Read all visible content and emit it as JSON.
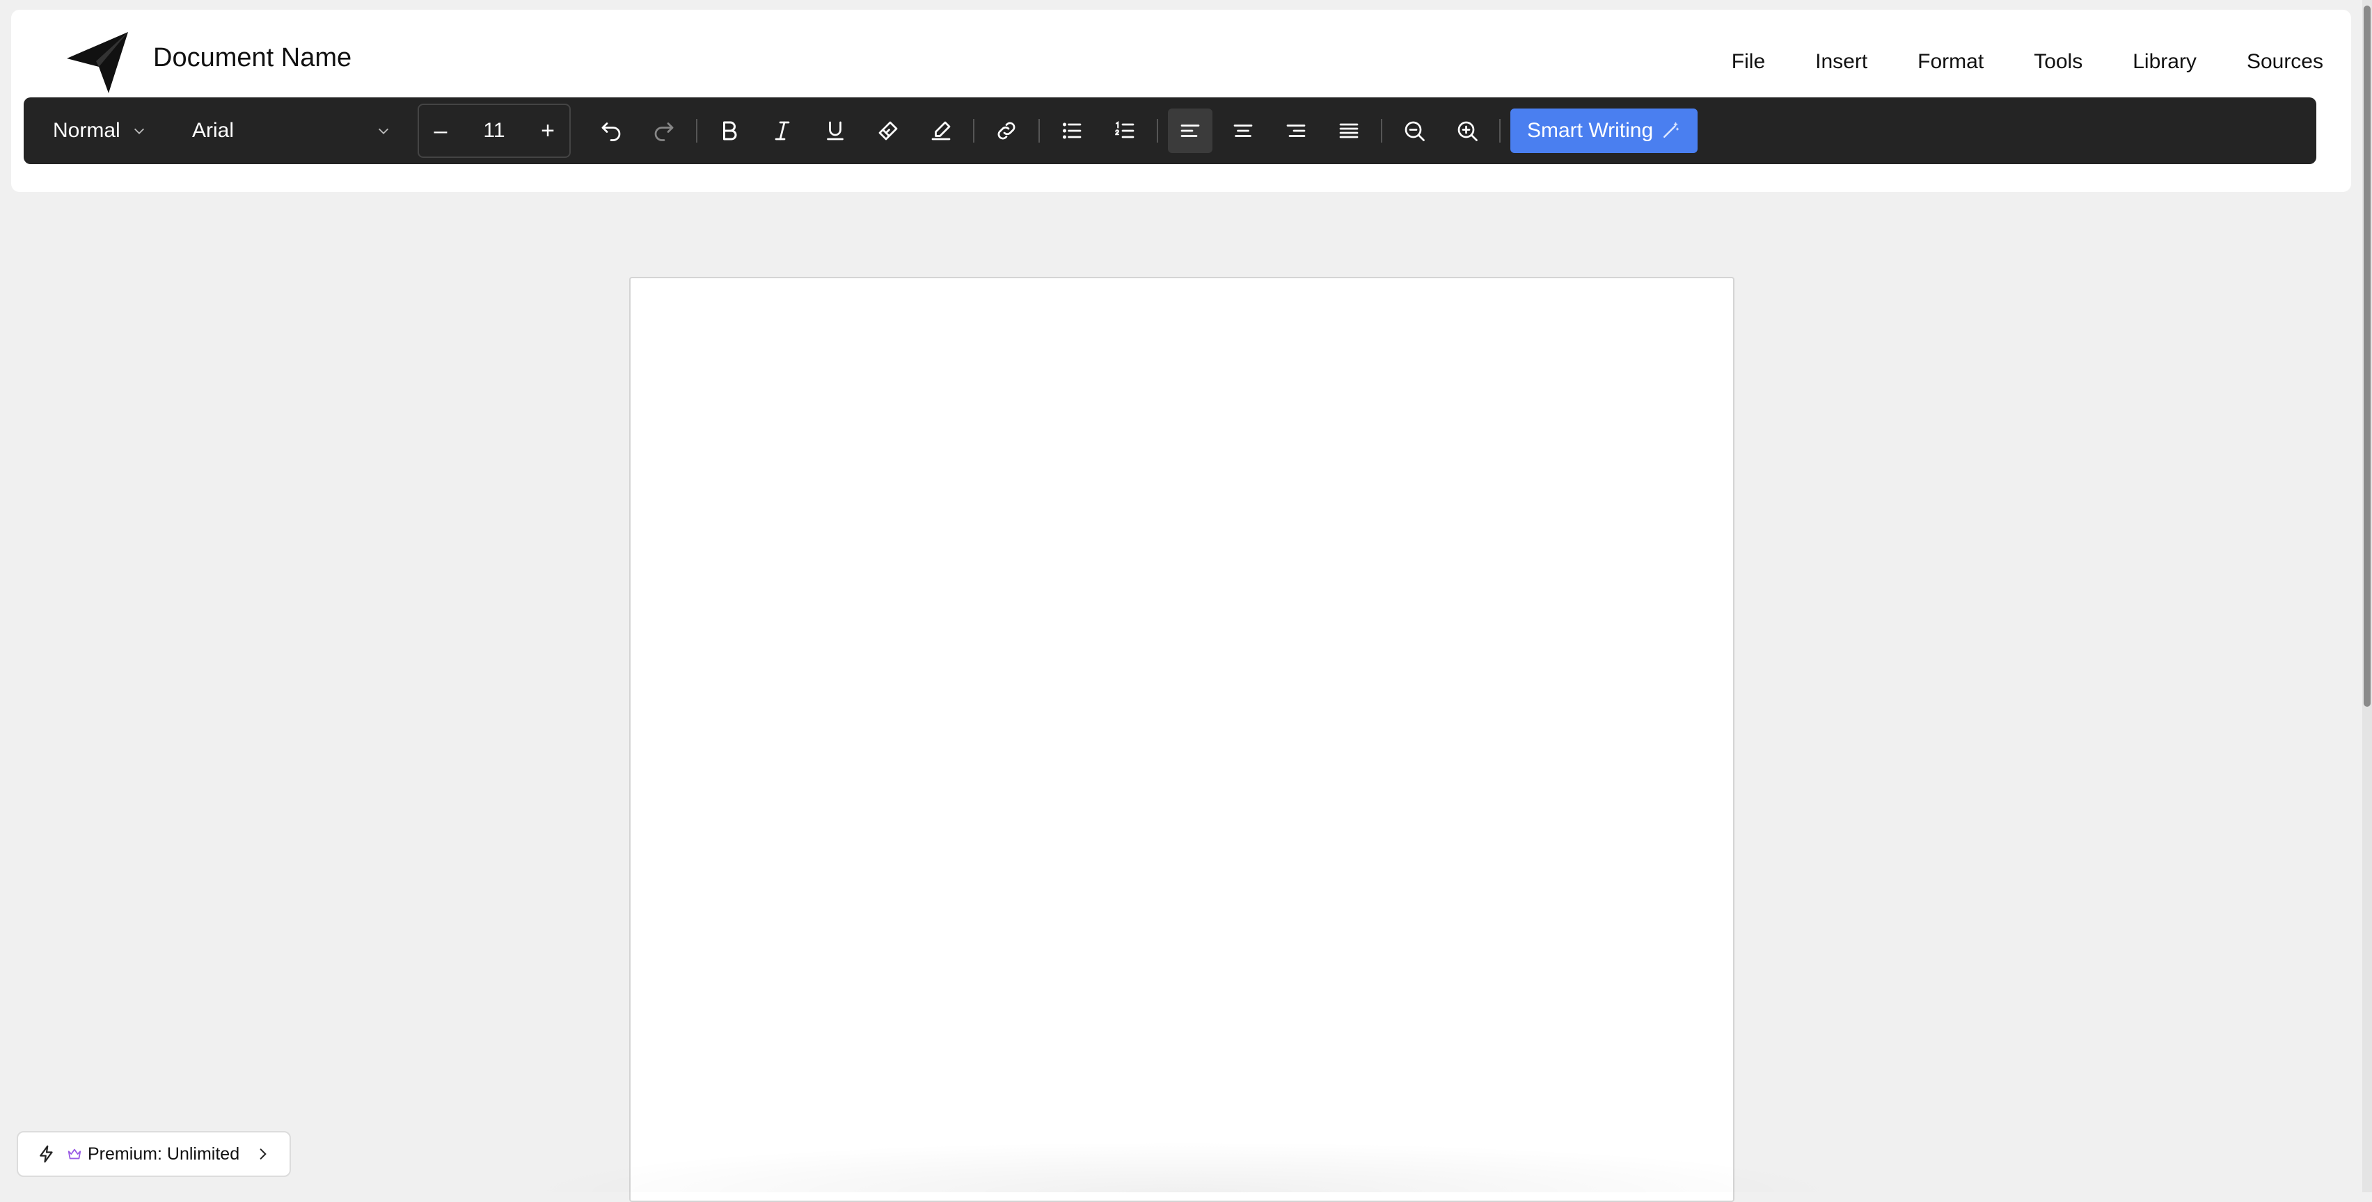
{
  "header": {
    "document_name": "Document Name",
    "menu": [
      {
        "label": "File"
      },
      {
        "label": "Insert"
      },
      {
        "label": "Format"
      },
      {
        "label": "Tools"
      },
      {
        "label": "Library"
      },
      {
        "label": "Sources"
      }
    ]
  },
  "toolbar": {
    "style_select": "Normal",
    "font_select": "Arial",
    "font_size": "11",
    "decrease_label": "–",
    "increase_label": "+",
    "smart_writing_label": "Smart Writing",
    "icons": {
      "undo": "undo-icon",
      "redo": "redo-icon",
      "bold": "bold-icon",
      "italic": "italic-icon",
      "underline": "underline-icon",
      "paint": "paint-format-icon",
      "clear": "clear-formatting-icon",
      "link": "link-icon",
      "bullet": "bulleted-list-icon",
      "numbered": "numbered-list-icon",
      "align_left": "align-left-icon",
      "align_center": "align-center-icon",
      "align_right": "align-right-icon",
      "justify": "align-justify-icon",
      "zoom_out": "zoom-out-icon",
      "zoom_in": "zoom-in-icon",
      "wand": "magic-wand-icon"
    },
    "active_alignment": "left"
  },
  "premium": {
    "label": "Premium: Unlimited"
  },
  "colors": {
    "toolbar_bg": "#242424",
    "accent": "#4a7ff0",
    "background": "#f0f0f0",
    "crown": "#9b5de5"
  }
}
